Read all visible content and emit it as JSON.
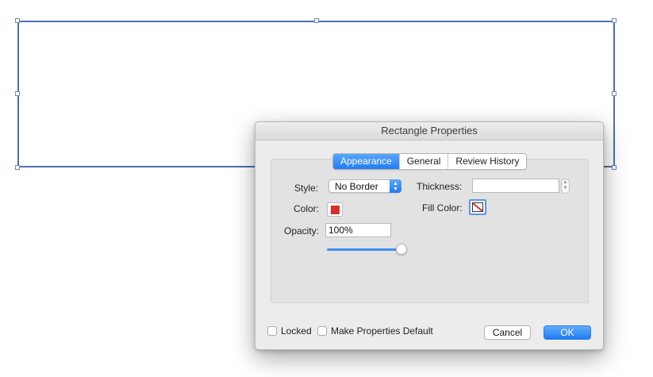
{
  "dialog": {
    "title": "Rectangle Properties",
    "tabs": [
      {
        "label": "Appearance",
        "active": true
      },
      {
        "label": "General",
        "active": false
      },
      {
        "label": "Review History",
        "active": false
      }
    ]
  },
  "appearance": {
    "style_label": "Style:",
    "style_value": "No Border",
    "thickness_label": "Thickness:",
    "thickness_value": "",
    "color_label": "Color:",
    "color_value": "#d9302b",
    "fill_color_label": "Fill Color:",
    "fill_color_value": "none",
    "opacity_label": "Opacity:",
    "opacity_value": "100%",
    "opacity_fraction": 1.0
  },
  "footer": {
    "locked_label": "Locked",
    "locked_checked": false,
    "make_default_label": "Make Properties Default",
    "make_default_checked": false,
    "cancel_label": "Cancel",
    "ok_label": "OK"
  },
  "colors": {
    "accent": "#1f7cf3",
    "selection_border": "#4a6fb5",
    "border_color_swatch": "#d9302b"
  },
  "icons": [
    "chevron-updown-icon",
    "stepper-icon",
    "no-fill-icon"
  ]
}
